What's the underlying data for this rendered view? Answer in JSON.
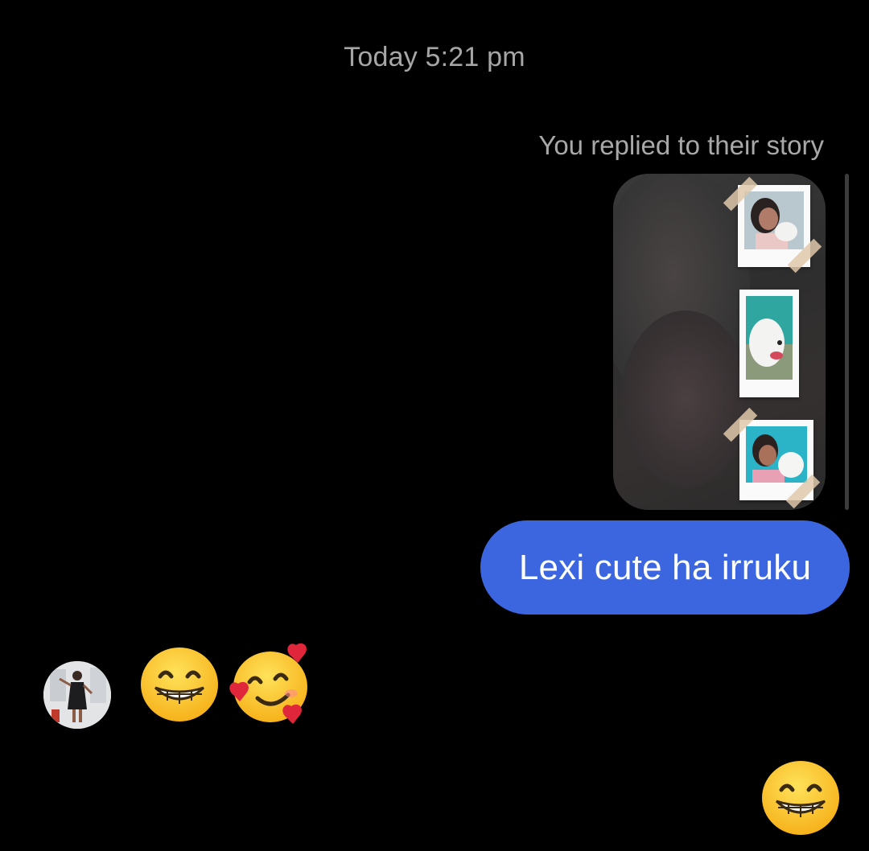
{
  "conversation": {
    "timestamp": "Today 5:21 pm",
    "story_reply_caption": "You replied to their story",
    "sent_message": "Lexi cute ha irruku",
    "received_reactions": [
      "grinning-face-emoji",
      "smiling-face-with-hearts-emoji"
    ],
    "sent_reaction": "grinning-face-emoji"
  },
  "colors": {
    "background": "#000000",
    "sent_bubble": "#3b66e0",
    "meta_text": "#a6a6a6"
  }
}
